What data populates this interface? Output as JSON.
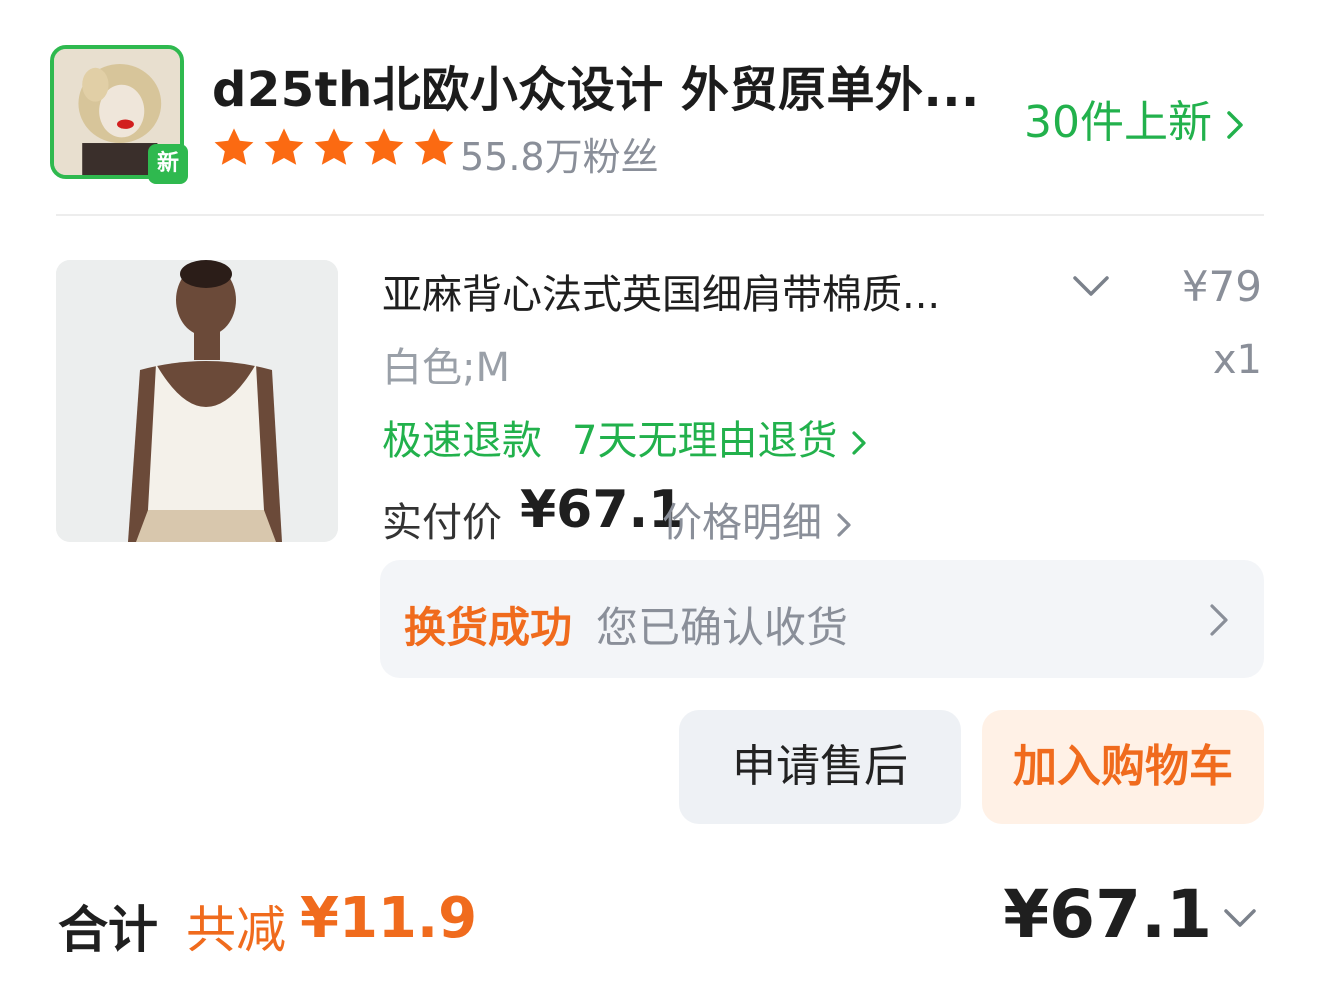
{
  "shop": {
    "name": "d25th北欧小众设计 外贸原单外...",
    "badge": "新",
    "fans": "55.8万粉丝",
    "rating_stars": 5,
    "new_items": "30件上新",
    "avatar_icon": "shop-avatar-photo",
    "brand_color": "#2fb94f"
  },
  "product": {
    "title": "亚麻背心法式英国细肩带棉质...",
    "price": "¥79",
    "spec": "白色;M",
    "quantity": "x1",
    "tag_fast_refund": "极速退款",
    "tag_return": "7天无理由退货",
    "paid_label": "实付价",
    "paid_amount": "¥67.1",
    "price_detail": "价格明细",
    "image_icon": "product-photo"
  },
  "status": {
    "title": "换货成功",
    "text": "您已确认收货",
    "accent_color": "#f06b1d"
  },
  "actions": {
    "after_sale": "申请售后",
    "add_to_cart": "加入购物车"
  },
  "footer": {
    "total_label": "合计",
    "discount_label": "共减",
    "discount_amount": "¥11.9",
    "total_amount": "¥67.1"
  }
}
